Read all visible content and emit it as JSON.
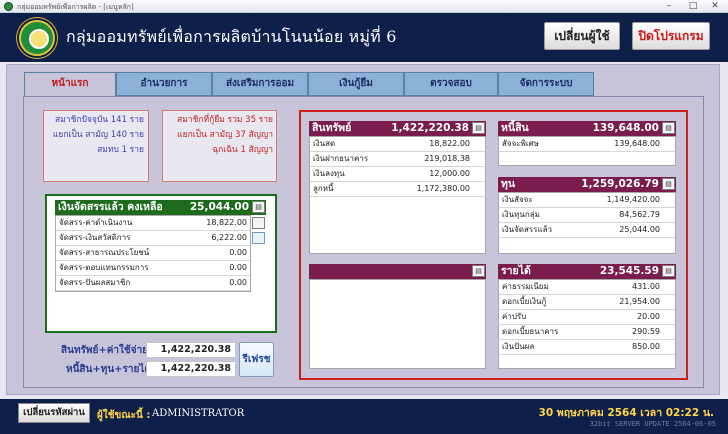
{
  "window": {
    "title": "กลุ่มออมทรัพย์เพื่อการผลิต - [เมนูหลัก]"
  },
  "header": {
    "title": "กลุ่มออมทรัพย์เพื่อการผลิตบ้านโนนน้อย หมู่ที่ 6",
    "switch_user": "เปลี่ยนผู้ใช้",
    "close_program": "ปิดโปรแกรม"
  },
  "tabs": [
    "หน้าแรก",
    "อำนวยการ",
    "ส่งเสริมการออม",
    "เงินกู้ยืม",
    "ตรวจสอบ",
    "จัดการระบบ"
  ],
  "members_info": [
    "สมาชิกปัจจุบัน 141 ราย",
    "แยกเป็น สามัญ 140 ราย",
    "สมทบ 1 ราย"
  ],
  "loan_info": [
    "สมาชิกที่กู้ยืม รวม 35 ราย",
    "แยกเป็น สามัญ 37 สัญญา",
    "ฉุกเฉิน 1 สัญญา"
  ],
  "allocation": {
    "title": "เงินจัดสรรแล้ว คงเหลือ",
    "total": "25,044.00",
    "rows": [
      {
        "name": "จัดสรร-ค่าดำเนินงาน",
        "value": "18,822.00"
      },
      {
        "name": "จัดสรร-เงินสวัสดิการ",
        "value": "6,222.00"
      },
      {
        "name": "จัดสรร-สาธารณประโยชน์",
        "value": "0.00"
      },
      {
        "name": "จัดสรร-ตอบแทนกรรมการ",
        "value": "0.00"
      },
      {
        "name": "จัดสรร-ปันผลสมาชิก",
        "value": "0.00"
      }
    ]
  },
  "assets": {
    "title": "สินทรัพย์",
    "total": "1,422,220.38",
    "rows": [
      {
        "name": "เงินสด",
        "value": "18,822.00"
      },
      {
        "name": "เงินฝากธนาคาร",
        "value": "219,018.38"
      },
      {
        "name": "เงินลงทุน",
        "value": "12,000.00"
      },
      {
        "name": "ลูกหนี้",
        "value": "1,172,380.00"
      }
    ]
  },
  "liabilities": {
    "title": "หนี้สิน",
    "total": "139,648.00",
    "rows": [
      {
        "name": "สัจจะพิเศษ",
        "value": "139,648.00"
      }
    ]
  },
  "capital": {
    "title": "ทุน",
    "total": "1,259,026.79",
    "rows": [
      {
        "name": "เงินสัจจะ",
        "value": "1,149,420.00"
      },
      {
        "name": "เงินทุนกลุ่ม",
        "value": "84,562.79"
      },
      {
        "name": "เงินจัดสรรแล้ว",
        "value": "25,044.00"
      }
    ]
  },
  "income": {
    "title": "รายได้",
    "total": "23,545.59",
    "rows": [
      {
        "name": "ค่าธรรมเนียม",
        "value": "431.00"
      },
      {
        "name": "ดอกเบี้ยเงินกู้",
        "value": "21,954.00"
      },
      {
        "name": "ค่าปรับ",
        "value": "20.00"
      },
      {
        "name": "ดอกเบี้ยธนาคาร",
        "value": "290.59"
      },
      {
        "name": "เงินปันผล",
        "value": "850.00"
      }
    ]
  },
  "totals": {
    "assets_expenses_label": "สินทรัพย์+ค่าใช้จ่าย",
    "assets_expenses": "1,422,220.38",
    "liab_cap_income_label": "หนี้สิน+ทุน+รายได้",
    "liab_cap_income": "1,422,220.38",
    "refresh": "รีเฟรช"
  },
  "status": {
    "change_password": "เปลี่ยนรหัสผ่าน",
    "user_label": "ผู้ใช้ขณะนี้ :",
    "user": "ADMINISTRATOR",
    "datetime": "30 พฤษภาคม 2564  เวลา 02:22 น.",
    "build": "32bit SERVER   UPDATE 2564-06-05"
  }
}
